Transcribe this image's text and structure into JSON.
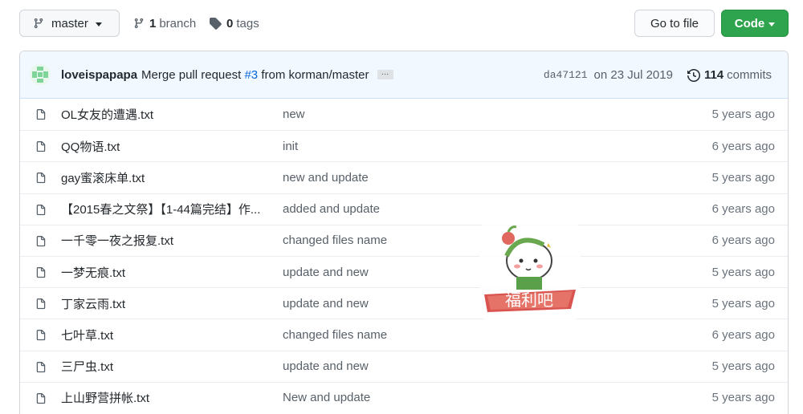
{
  "toolbar": {
    "branch_name": "master",
    "branch_count": "1",
    "branch_label": "branch",
    "tag_count": "0",
    "tag_label": "tags",
    "go_to_file": "Go to file",
    "code": "Code"
  },
  "commit": {
    "author": "loveispapapa",
    "message_pre": "Merge pull request",
    "pr_link": "#3",
    "message_post": "from korman/master",
    "ellipsis": "…",
    "sha": "da47121",
    "date": "on 23 Jul 2019",
    "commit_count": "114",
    "commit_label": "commits"
  },
  "files": [
    {
      "name": "OL女友的遭遇.txt",
      "message": "new",
      "age": "5 years ago"
    },
    {
      "name": "QQ物语.txt",
      "message": "init",
      "age": "6 years ago"
    },
    {
      "name": "gay蜜滚床单.txt",
      "message": "new and update",
      "age": "5 years ago"
    },
    {
      "name": "【2015春之文祭】【1-44篇完结】作...",
      "message": "added and update",
      "age": "6 years ago"
    },
    {
      "name": "一千零一夜之报复.txt",
      "message": "changed files name",
      "age": "6 years ago"
    },
    {
      "name": "一梦无痕.txt",
      "message": "update and new",
      "age": "5 years ago"
    },
    {
      "name": "丁家云雨.txt",
      "message": "update and new",
      "age": "5 years ago"
    },
    {
      "name": "七叶草.txt",
      "message": "changed files name",
      "age": "6 years ago"
    },
    {
      "name": "三尸虫.txt",
      "message": "update and new",
      "age": "5 years ago"
    },
    {
      "name": "上山野营拼帐.txt",
      "message": "New and update",
      "age": "5 years ago"
    }
  ],
  "watermark": {
    "text": "福利吧"
  },
  "icons": {
    "branch": "git-branch-icon",
    "tag": "tag-icon",
    "history": "history-icon",
    "file": "file-icon"
  },
  "colors": {
    "code_button": "#2ea44f",
    "commit_bar_bg": "#f1f8ff",
    "link": "#0366d6"
  }
}
